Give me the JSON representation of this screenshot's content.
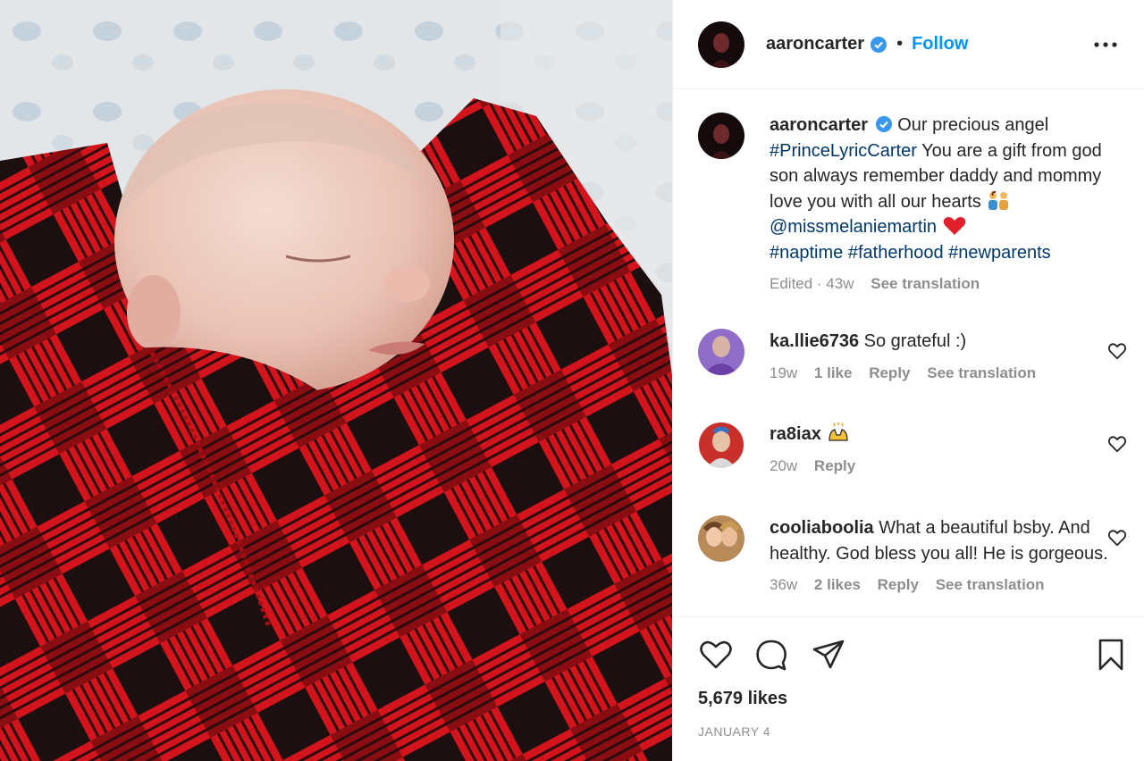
{
  "post": {
    "username": "aaroncarter",
    "follow_label": "Follow",
    "separator": "•",
    "photo_alt": "sleeping newborn wrapped in red and black buffalo plaid blanket"
  },
  "caption": {
    "username": "aaroncarter",
    "text_1": "Our precious angel",
    "hashtag_1": "#PrinceLyricCarter",
    "text_2": "You are a gift from god son always remember daddy and mommy love you with all our hearts",
    "mention": "@missmelaniemartin",
    "hashtags": "#naptime #fatherhood #newparents",
    "edited": "Edited · 43w",
    "see_translation": "See translation"
  },
  "comments": [
    {
      "username": "ka.llie6736",
      "text": "So grateful :)",
      "time": "19w",
      "likes": "1 like",
      "reply": "Reply",
      "translate": "See translation"
    },
    {
      "username": "ra8iax",
      "text": "",
      "time": "20w",
      "reply": "Reply"
    },
    {
      "username": "cooliaboolia",
      "text": "What a beautiful bsby. And healthy. God bless you all! He is gorgeous.",
      "time": "36w",
      "likes": "2 likes",
      "reply": "Reply",
      "translate": "See translation"
    }
  ],
  "footer": {
    "likes": "5,679 likes",
    "date": "JANUARY 4"
  },
  "colors": {
    "accent": "#0095f6",
    "verified": "#3897f0",
    "text": "#262626",
    "muted": "#8e8e8e",
    "link": "#00376b"
  },
  "icons": [
    "verified-badge-icon",
    "more-options-icon",
    "heart-icon",
    "comment-icon",
    "share-icon",
    "bookmark-icon",
    "family-emoji-icon",
    "red-heart-emoji-icon",
    "raising-hands-emoji-icon"
  ]
}
